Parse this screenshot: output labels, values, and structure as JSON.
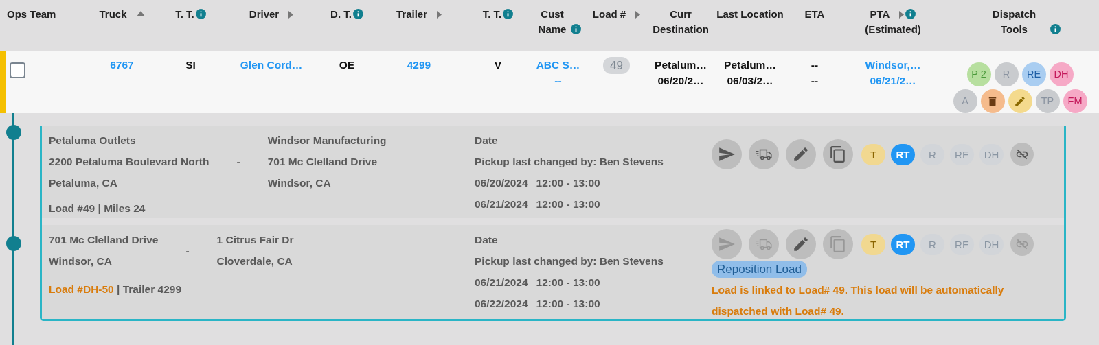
{
  "header": {
    "columns": [
      {
        "label": "Ops Team"
      },
      {
        "label": "Truck",
        "sorted_ascending": true
      },
      {
        "label": "T. T.",
        "info": true
      },
      {
        "label": "Driver",
        "menu": true
      },
      {
        "label": "D. T.",
        "info": true
      },
      {
        "label": "Trailer",
        "menu": true
      },
      {
        "label": "T. T.",
        "info": true
      },
      {
        "label": "Cust Name",
        "info": true
      },
      {
        "label": "Load #",
        "menu": true
      },
      {
        "label": "Curr Destination"
      },
      {
        "label": "Last Location"
      },
      {
        "label": "ETA"
      },
      {
        "label": "PTA",
        "menu": true,
        "info": true,
        "sublabel": "(Estimated)"
      },
      {
        "label": "Dispatch Tools",
        "info": true
      }
    ]
  },
  "row": {
    "flagged": true,
    "cells": [
      {
        "kind": "checkbox",
        "checked": false
      },
      {
        "kind": "link",
        "lines": [
          "6767"
        ]
      },
      {
        "kind": "plain",
        "lines": [
          "SI"
        ]
      },
      {
        "kind": "link",
        "lines": [
          "Glen Cord…"
        ]
      },
      {
        "kind": "plain",
        "lines": [
          "OE"
        ]
      },
      {
        "kind": "link",
        "lines": [
          "4299"
        ]
      },
      {
        "kind": "plain",
        "lines": [
          "V"
        ]
      },
      {
        "kind": "link",
        "lines": [
          "ABC S…",
          "--"
        ]
      },
      {
        "kind": "pill",
        "lines": [
          "49"
        ]
      },
      {
        "kind": "plain",
        "lines": [
          "Petalum…",
          "06/20/2…"
        ]
      },
      {
        "kind": "plain",
        "lines": [
          "Petalum…",
          "06/03/2…"
        ]
      },
      {
        "kind": "plain",
        "lines": [
          "--",
          "--"
        ]
      },
      {
        "kind": "link",
        "lines": [
          "Windsor,…",
          "06/21/2…"
        ]
      },
      {
        "kind": "tools",
        "rows": [
          [
            {
              "kind": "text",
              "label": "P 2",
              "color": "#b7df9f"
            },
            {
              "kind": "text",
              "label": "R",
              "color": "#c9cbce"
            },
            {
              "kind": "text",
              "label": "RE",
              "color": "#a9cdf1"
            },
            {
              "kind": "text",
              "label": "DH",
              "color": "#f6a9c6"
            }
          ],
          [
            {
              "kind": "text",
              "label": "A",
              "color": "#c9cbce"
            },
            {
              "kind": "trash",
              "color": "#f5bb8c"
            },
            {
              "kind": "pencil",
              "color": "#f4da8d"
            },
            {
              "kind": "text",
              "label": "TP",
              "color": "#c9cbce"
            },
            {
              "kind": "text",
              "label": "FM",
              "color": "#f6a9c6"
            }
          ]
        ]
      }
    ]
  },
  "stops": [
    {
      "origin": [
        "Petaluma Outlets",
        "2200 Petaluma Boulevard North",
        "Petaluma, CA"
      ],
      "separator": "-",
      "destination": [
        "Windsor Manufacturing",
        "701 Mc Clelland Drive",
        "Windsor, CA"
      ],
      "load_label": "Load #49",
      "load_highlight": false,
      "load_detail": "| Miles 24",
      "date_heading": "Date",
      "changed_by": "Pickup last changed by: Ben Stevens",
      "windows": [
        {
          "date": "06/20/2024",
          "time": "12:00 - 13:00"
        },
        {
          "date": "06/21/2024",
          "time": "12:00 - 13:00"
        }
      ],
      "actions": [
        {
          "kind": "send",
          "disabled": false
        },
        {
          "kind": "truck",
          "disabled": false
        },
        {
          "kind": "edit",
          "disabled": false
        },
        {
          "kind": "copy",
          "disabled": false
        }
      ],
      "chips": [
        {
          "label": "T",
          "color": "#f1d890",
          "selected": false
        },
        {
          "label": "RT",
          "color": "#2196f3",
          "selected": true
        },
        {
          "label": "R",
          "color": "#d2d5d9",
          "selected": false
        },
        {
          "label": "RE",
          "color": "#d2d5d9",
          "selected": false
        },
        {
          "label": "DH",
          "color": "#d2d5d9",
          "selected": false
        }
      ],
      "unlink_disabled": false
    },
    {
      "origin": [
        "701 Mc Clelland Drive",
        "Windsor, CA"
      ],
      "separator": "-",
      "destination": [
        "1 Citrus Fair Dr",
        "Cloverdale, CA"
      ],
      "load_label": "Load #DH-50",
      "load_highlight": true,
      "load_detail": "| Trailer 4299",
      "date_heading": "Date",
      "changed_by": "Pickup last changed by: Ben Stevens",
      "windows": [
        {
          "date": "06/21/2024",
          "time": "12:00 - 13:00"
        },
        {
          "date": "06/22/2024",
          "time": "12:00 - 13:00"
        }
      ],
      "actions": [
        {
          "kind": "send",
          "disabled": true
        },
        {
          "kind": "truck",
          "disabled": true
        },
        {
          "kind": "edit",
          "disabled": false
        },
        {
          "kind": "copy",
          "disabled": true
        }
      ],
      "chips": [
        {
          "label": "T",
          "color": "#f1d890",
          "selected": false
        },
        {
          "label": "RT",
          "color": "#2196f3",
          "selected": true
        },
        {
          "label": "R",
          "color": "#d2d5d9",
          "selected": false
        },
        {
          "label": "RE",
          "color": "#d2d5d9",
          "selected": false
        },
        {
          "label": "DH",
          "color": "#d2d5d9",
          "selected": false
        }
      ],
      "unlink_disabled": true,
      "tag": "Reposition Load",
      "note": "Load is linked to Load# 49. This load will be automatically dispatched with Load# 49."
    }
  ]
}
